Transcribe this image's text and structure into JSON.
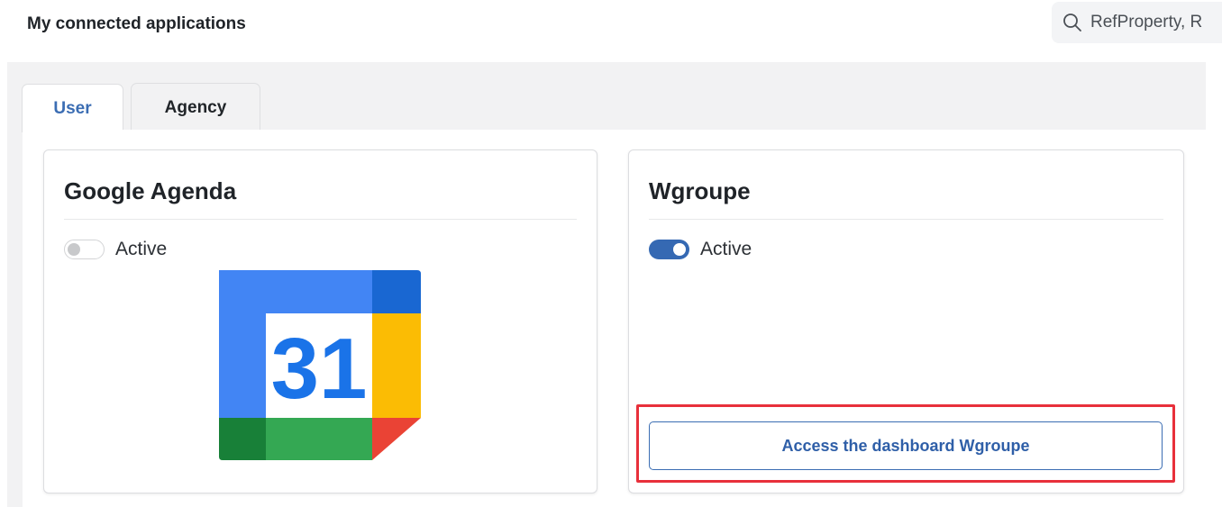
{
  "header": {
    "title": "My connected applications",
    "search_value": "RefProperty, R",
    "search_icon": "search-icon"
  },
  "tabs": [
    {
      "label": "User",
      "active": true
    },
    {
      "label": "Agency",
      "active": false
    }
  ],
  "cards": [
    {
      "title": "Google Agenda",
      "toggle_label": "Active",
      "toggle_on": false,
      "logo_text": "31",
      "logo_icon": "google-calendar-logo"
    },
    {
      "title": "Wgroupe",
      "toggle_label": "Active",
      "toggle_on": true,
      "button_label": "Access the dashboard Wgroupe"
    }
  ],
  "colors": {
    "accent": "#3569b3",
    "highlight": "#e8303b",
    "page_bg": "#f2f2f3"
  }
}
